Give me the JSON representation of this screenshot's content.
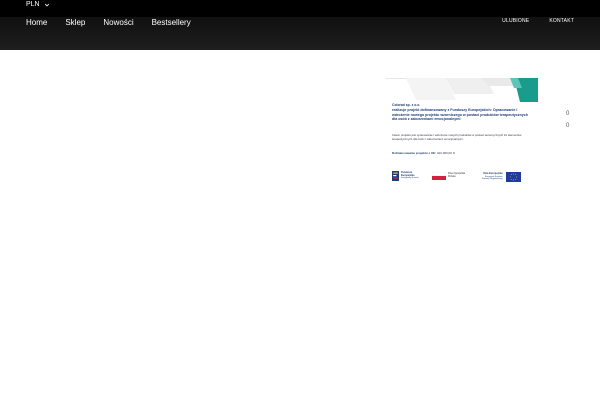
{
  "topbar": {
    "currency": "PLN",
    "currency_icon": "chevron-down-icon"
  },
  "nav": {
    "links": [
      "Home",
      "Sklep",
      "Nowości",
      "Bestsellery"
    ],
    "right": [
      "ULUBIONE",
      "KONTAKT"
    ]
  },
  "counters": [
    "0",
    "0"
  ],
  "banner": {
    "company": "Colorad sp. z o.o.",
    "title": "realizuje projekt dofinansowany z Funduszy Europejskich: Opracowanie i wdrożenie nowego projektu wzorniczego w postaci produktów terapeutycznych dla osób z zaburzeniami emocjonalnymi",
    "description": "Celem projektu jest opracowanie i wdrożenie nowych produktów w postaci sensorycznych 10 elementów terapeutycznych dla osób z zaburzeniami emocjonalnymi.",
    "funding_label": "Dofinansowanie projektu z UE:",
    "funding_value": "420 000,00 zł",
    "logos": {
      "fe_line1": "Fundusze",
      "fe_line2": "Europejskie",
      "fe_line3": "Inteligentny Rozwój",
      "pl_line1": "Rzeczpospolita",
      "pl_line2": "Polska",
      "eu_line1": "Unia Europejska",
      "eu_line2": "Europejski Fundusz",
      "eu_line3": "Rozwoju Regionalnego"
    },
    "colors": {
      "navy": "#1f3c78",
      "teal": "#1a9c8c",
      "red": "#d4213d"
    }
  }
}
